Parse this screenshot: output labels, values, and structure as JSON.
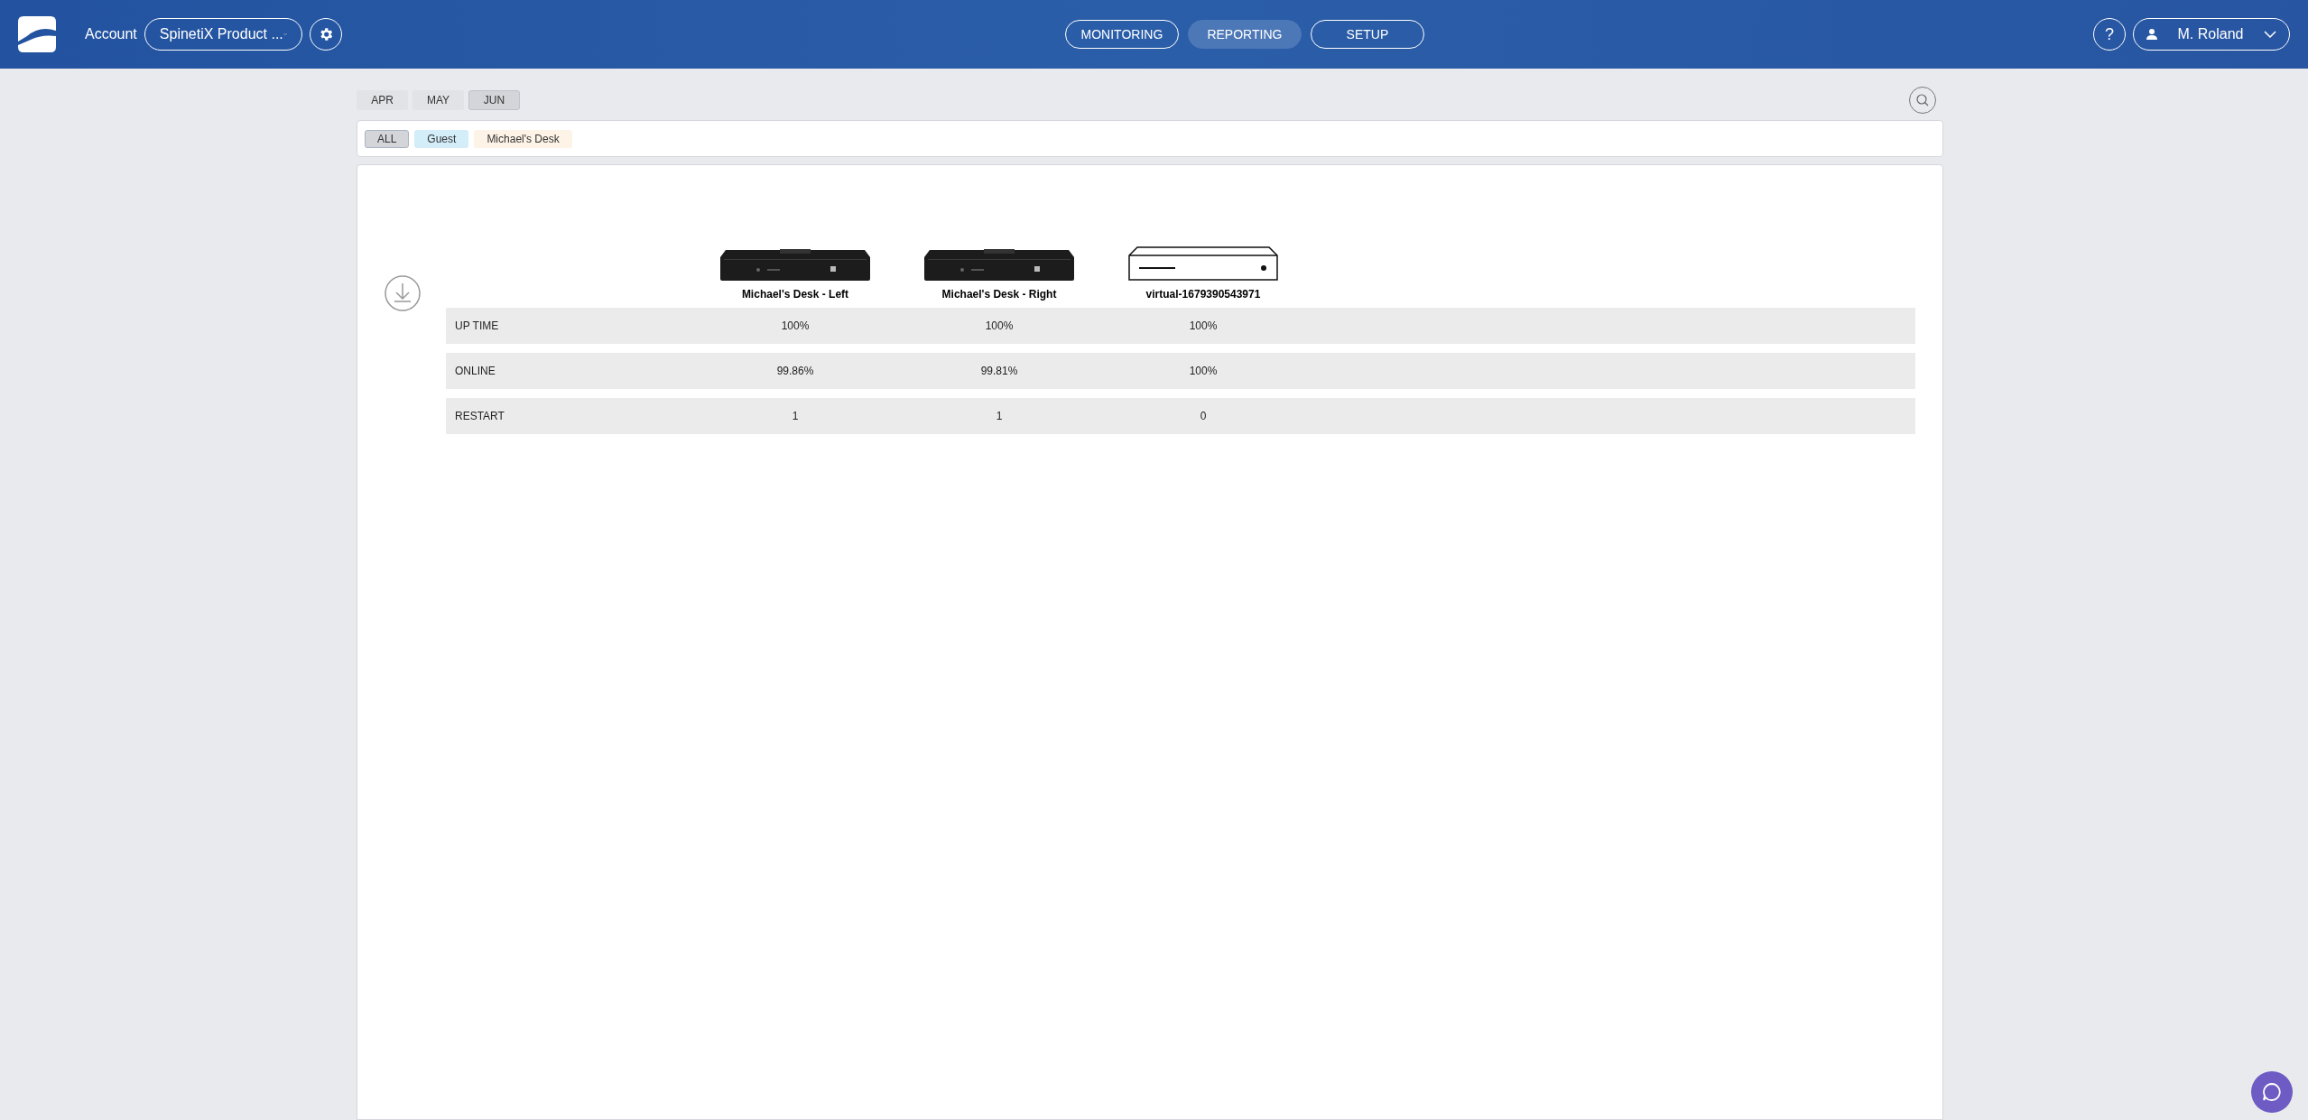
{
  "header": {
    "account_label": "Account",
    "account_select": "SpinetiX Product ...",
    "nav": [
      {
        "label": "MONITORING",
        "selected": false
      },
      {
        "label": "REPORTING",
        "selected": true
      },
      {
        "label": "SETUP",
        "selected": false
      }
    ],
    "help": "?",
    "user": "M. Roland"
  },
  "months": [
    {
      "label": "APR",
      "selected": false
    },
    {
      "label": "MAY",
      "selected": false
    },
    {
      "label": "JUN",
      "selected": true
    }
  ],
  "tags": [
    {
      "label": "ALL",
      "selected": true,
      "color": "#d4d5d8"
    },
    {
      "label": "Guest",
      "selected": false,
      "color": "#d3edf9"
    },
    {
      "label": "Michael's Desk",
      "selected": false,
      "color": "#fdf3e7"
    }
  ],
  "devices": [
    {
      "name": "Michael's Desk - Left",
      "kind": "player"
    },
    {
      "name": "Michael's Desk - Right",
      "kind": "player"
    },
    {
      "name": "virtual-1679390543971",
      "kind": "virtual"
    }
  ],
  "rows": [
    {
      "label": "UP TIME",
      "values": [
        "100%",
        "100%",
        "100%"
      ]
    },
    {
      "label": "ONLINE",
      "values": [
        "99.86%",
        "99.81%",
        "100%"
      ]
    },
    {
      "label": "RESTART",
      "values": [
        "1",
        "1",
        "0"
      ]
    }
  ]
}
